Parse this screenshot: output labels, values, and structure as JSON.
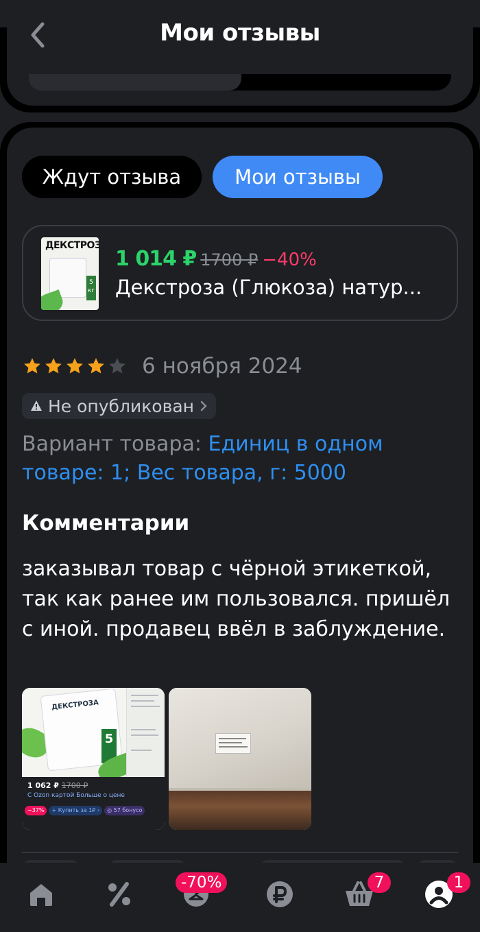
{
  "header": {
    "title": "Мои отзывы"
  },
  "tabs": [
    {
      "label": "Ждут отзыва",
      "active": false
    },
    {
      "label": "Мои отзывы",
      "active": true
    }
  ],
  "product": {
    "price": "1 014 ₽",
    "old_price": "1700 ₽",
    "discount": "−40%",
    "name": "Декстроза (Глюкоза) натур...",
    "thumb_title": "ДЕКСТРОЗА",
    "thumb_kg": "5 кг"
  },
  "review": {
    "rating": 4,
    "max_rating": 5,
    "date": "6 ноября 2024",
    "status": "Не опубликован",
    "variant_label": "Вариант товара:",
    "variant_value": "Единиц в одном товаре: 1; Вес товара, г: 5000",
    "comments_title": "Комментарии",
    "comment": "заказывал товар с чёрной этикеткой, так как ранее им пользовался. пришёл с иной. продавец ввёл в заблуждение."
  },
  "photos": {
    "photo1": {
      "bag_title": "ДЕКСТРОЗА",
      "kg": "5",
      "price": "1 062 ₽",
      "old_price": "1700 ₽",
      "ozon_text": "С Ozon картой   Больше о цене",
      "chips": [
        "−37%",
        "+ Купить за 1₽ ›",
        "◎ 57 бонусо"
      ]
    }
  },
  "bottom_nav": {
    "items": [
      {
        "name": "home",
        "icon": "home-icon"
      },
      {
        "name": "discounts",
        "icon": "percent-icon"
      },
      {
        "name": "fresh",
        "icon": "hanger-icon",
        "badge": "-70%"
      },
      {
        "name": "finance",
        "icon": "ruble-icon"
      },
      {
        "name": "cart",
        "icon": "basket-icon",
        "badge": "7"
      },
      {
        "name": "profile",
        "icon": "profile-icon",
        "badge": "1"
      }
    ]
  },
  "colors": {
    "background": "#1d1f23",
    "accent_blue": "#3f8af5",
    "price_green": "#2cd36a",
    "discount_red": "#ff3b6b",
    "badge_pink": "#f1115b",
    "star_orange": "#f7a21b"
  }
}
